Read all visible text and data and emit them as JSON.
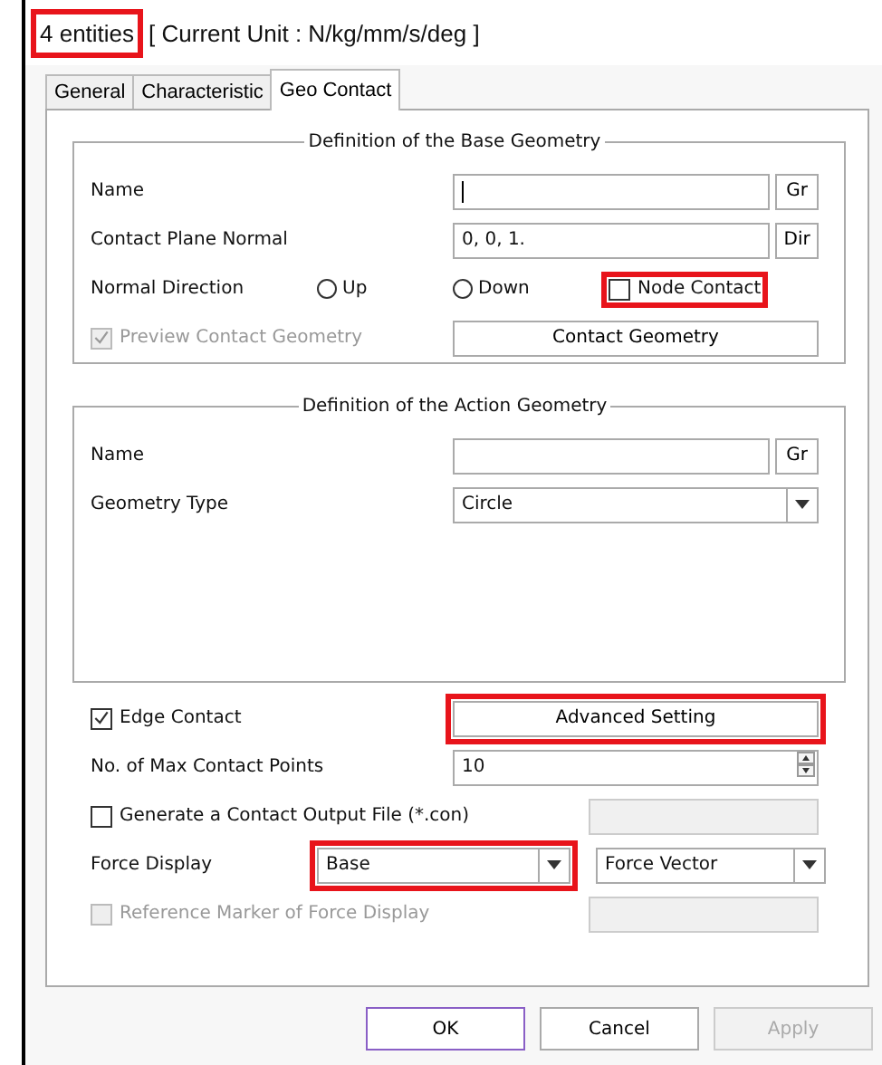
{
  "header": {
    "entity_count": "4 entities",
    "entity_count_highlighted": true,
    "unit": "[ Current Unit : N/kg/mm/s/deg ]"
  },
  "tabs": [
    {
      "label": "General",
      "selected": false
    },
    {
      "label": "Characteristic",
      "selected": false
    },
    {
      "label": "Geo Contact",
      "selected": true
    }
  ],
  "base_geometry": {
    "title": "Definition of the Base Geometry",
    "name": {
      "label": "Name",
      "button": "Gr",
      "focused": true
    },
    "plane_normal": {
      "label": "Contact Plane Normal",
      "value": "0, 0, 1.",
      "button": "Dir"
    },
    "normal_direction": {
      "label": "Normal Direction",
      "options": [
        {
          "label": "Up",
          "selected": false
        },
        {
          "label": "Down",
          "selected": false
        }
      ],
      "node_contact": {
        "label": "Node Contact",
        "checked": false,
        "highlighted": true
      }
    },
    "preview": {
      "label": "Preview Contact Geometry",
      "checked": true,
      "disabled": true
    },
    "contact_geometry_button": "Contact Geometry"
  },
  "action_geometry": {
    "title": "Definition of the Action Geometry",
    "name": {
      "label": "Name",
      "button": "Gr"
    },
    "geometry_type": {
      "label": "Geometry Type",
      "value": "Circle"
    }
  },
  "edge_contact": {
    "label": "Edge Contact",
    "checked": true
  },
  "advanced_button": {
    "label": "Advanced Setting",
    "highlighted": true
  },
  "max_points": {
    "label": "No. of Max Contact Points",
    "value": "10"
  },
  "output_file": {
    "label": "Generate a Contact Output File (*.con)",
    "checked": false
  },
  "force_display": {
    "label": "Force Display",
    "target": {
      "value": "Base",
      "highlighted": true
    },
    "mode": {
      "value": "Force Vector"
    }
  },
  "reference_marker": {
    "label": "Reference Marker of Force Display",
    "checked": false,
    "disabled": true
  },
  "buttons": [
    {
      "label": "OK",
      "default": true,
      "disabled": false
    },
    {
      "label": "Cancel",
      "default": false,
      "disabled": false
    },
    {
      "label": "Apply",
      "default": false,
      "disabled": true
    }
  ]
}
